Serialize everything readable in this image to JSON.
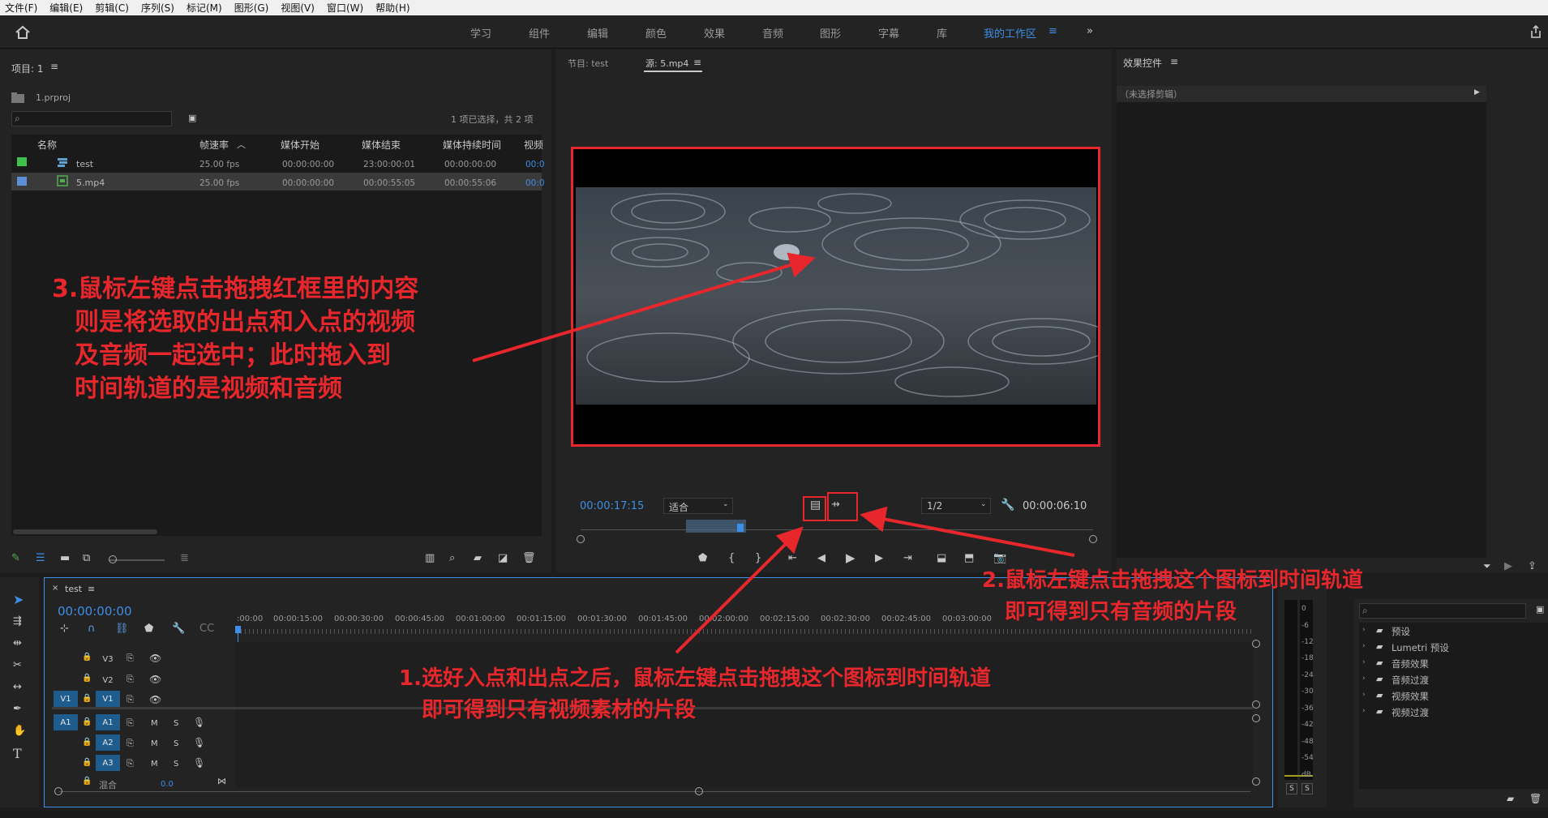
{
  "menu": [
    "文件(F)",
    "编辑(E)",
    "剪辑(C)",
    "序列(S)",
    "标记(M)",
    "图形(G)",
    "视图(V)",
    "窗口(W)",
    "帮助(H)"
  ],
  "workspaces": [
    "学习",
    "组件",
    "编辑",
    "颜色",
    "效果",
    "音频",
    "图形",
    "字幕",
    "库",
    "我的工作区"
  ],
  "project": {
    "title": "项目: 1",
    "file": "1.prproj",
    "selection_info": "1 项已选择，共 2 项",
    "columns": [
      "名称",
      "帧速率",
      "媒体开始",
      "媒体结束",
      "媒体持续时间",
      "视频"
    ],
    "rows": [
      {
        "name": "test",
        "fps": "25.00 fps",
        "start": "00:00:00:00",
        "end": "23:00:00:01",
        "duration": "00:00:00:00",
        "video": "00:0",
        "color": "#3fbf4c"
      },
      {
        "name": "5.mp4",
        "fps": "25.00 fps",
        "start": "00:00:00:00",
        "end": "00:00:55:05",
        "duration": "00:00:55:06",
        "video": "00:0",
        "color": "#5b8fd6"
      }
    ]
  },
  "monitor": {
    "program_tab": "节目: test",
    "source_tab": "源: 5.mp4",
    "timecode_in": "00:00:17:15",
    "fit": "适合",
    "resolution": "1/2",
    "timecode_out": "00:00:06:10"
  },
  "effects_control": {
    "title": "效果控件",
    "no_clip": "（未选择剪辑）"
  },
  "timeline": {
    "tab": "test",
    "timecode": "00:00:00:00",
    "ruler": [
      ":00:00",
      "00:00:15:00",
      "00:00:30:00",
      "00:00:45:00",
      "00:01:00:00",
      "00:01:15:00",
      "00:01:30:00",
      "00:01:45:00",
      "00:02:00:00",
      "00:02:15:00",
      "00:02:30:00",
      "00:02:45:00",
      "00:03:00:00"
    ],
    "video_tracks": [
      "V3",
      "V2",
      "V1"
    ],
    "audio_tracks": [
      "A1",
      "A2",
      "A3"
    ],
    "source_v": "V1",
    "source_a": "A1",
    "mix_label": "混合",
    "mix_value": "0.0",
    "m": "M",
    "s": "S"
  },
  "meter": {
    "labels": [
      "0",
      "-6",
      "-12",
      "-18",
      "-24",
      "-30",
      "-36",
      "-42",
      "-48",
      "-54",
      "dB"
    ],
    "solo": "S"
  },
  "effects": [
    "预设",
    "Lumetri 预设",
    "音频效果",
    "音频过渡",
    "视频效果",
    "视频过渡"
  ],
  "annotations": {
    "note3": [
      "3.鼠标左键点击拖拽红框里的内容",
      "则是将选取的出点和入点的视频",
      "及音频一起选中；此时拖入到",
      "时间轨道的是视频和音频"
    ],
    "note2": [
      "2.鼠标左键点击拖拽这个图标到时间轨道",
      "即可得到只有音频的片段"
    ],
    "note1": [
      "1.选好入点和出点之后，鼠标左键点击拖拽这个图标到时间轨道",
      "即可得到只有视频素材的片段"
    ],
    "color": "#e8272c"
  }
}
